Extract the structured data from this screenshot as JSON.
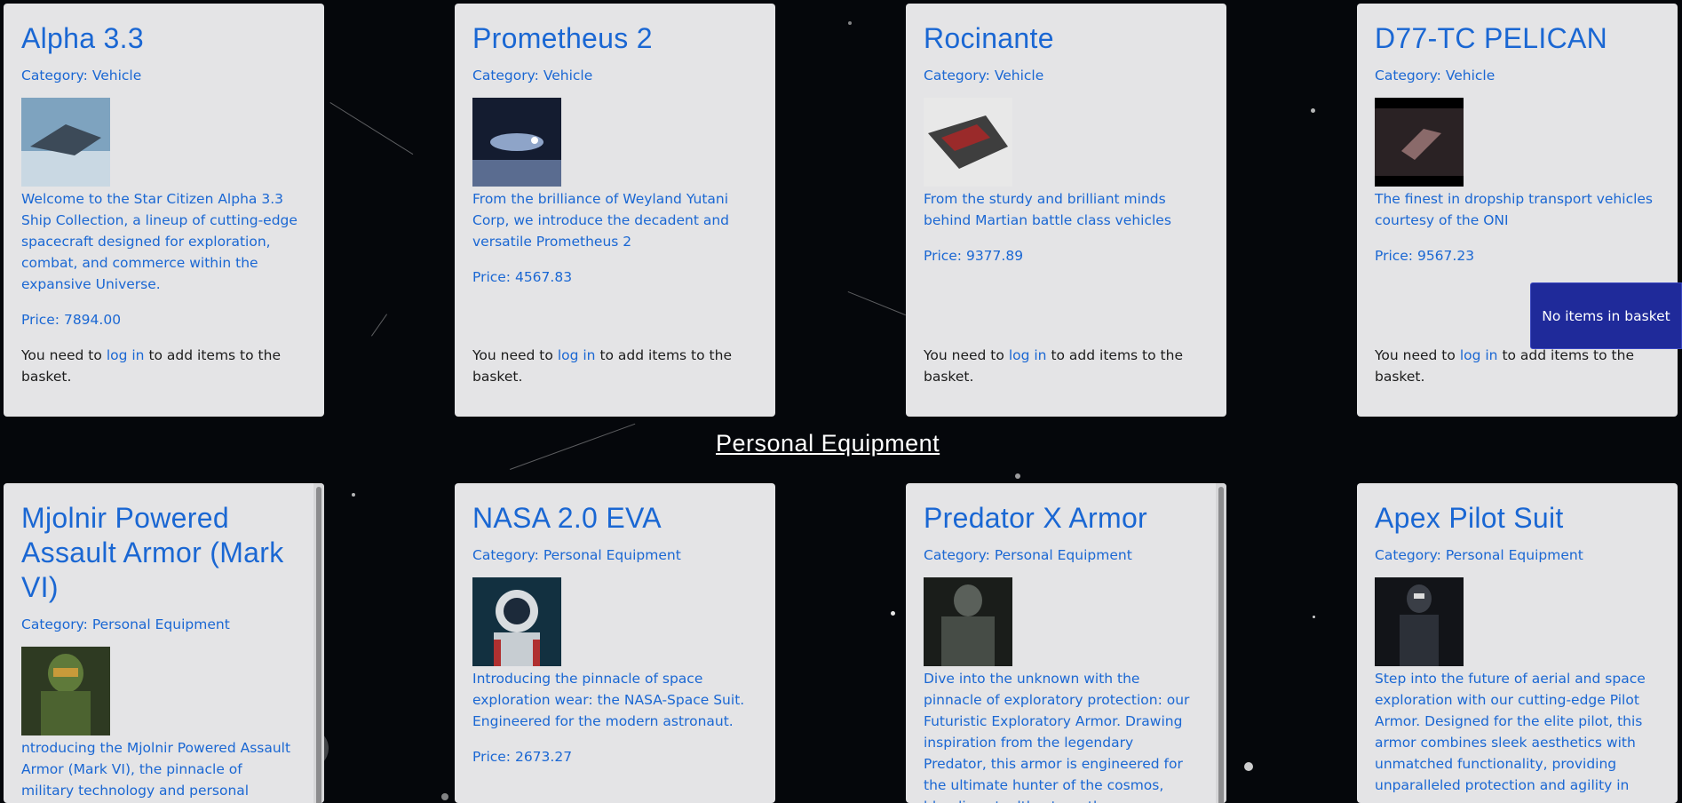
{
  "section": {
    "title": "Personal Equipment"
  },
  "login_prefix": "You need to",
  "login_link": "log in",
  "login_suffix": "to add items to the basket.",
  "basket": {
    "label": "No items in basket"
  },
  "products_row1": [
    {
      "title": "Alpha 3.3",
      "category": "Category: Vehicle",
      "description": "Welcome to the Star Citizen Alpha 3.3 Ship Collection, a lineup of cutting-edge spacecraft designed for exploration, combat, and commerce within the expansive Universe.",
      "price": "Price: 7894.00",
      "image": "spaceship-image"
    },
    {
      "title": "Prometheus 2",
      "category": "Category: Vehicle",
      "description": "From the brilliance of Weyland Yutani Corp, we introduce the decadent and versatile Prometheus 2",
      "price": "Price: 4567.83",
      "image": "spaceship-image"
    },
    {
      "title": "Rocinante",
      "category": "Category: Vehicle",
      "description": "From the sturdy and brilliant minds behind Martian battle class vehicles",
      "price": "Price: 9377.89",
      "image": "spaceship-image"
    },
    {
      "title": "D77-TC PELICAN",
      "category": "Category: Vehicle",
      "description": "The finest in dropship transport vehicles courtesy of the ONI",
      "price": "Price: 9567.23",
      "image": "dropship-image"
    }
  ],
  "products_row2": [
    {
      "title": "Mjolnir Powered Assault Armor (Mark VI)",
      "category": "Category: Personal Equipment",
      "description": "ntroducing the Mjolnir Powered Assault Armor (Mark VI), the pinnacle of military technology and personal protection in",
      "image": "armor-image"
    },
    {
      "title": "NASA 2.0 EVA",
      "category": "Category: Personal Equipment",
      "description": "Introducing the pinnacle of space exploration wear: the NASA-Space Suit. Engineered for the modern astronaut.",
      "price": "Price: 2673.27",
      "image": "astronaut-image"
    },
    {
      "title": "Predator X Armor",
      "category": "Category: Personal Equipment",
      "description": "Dive into the unknown with the pinnacle of exploratory protection: our Futuristic Exploratory Armor. Drawing inspiration from the legendary Predator, this armor is engineered for the ultimate hunter of the cosmos, blending stealth, strength,",
      "image": "armor-image"
    },
    {
      "title": "Apex Pilot Suit",
      "category": "Category: Personal Equipment",
      "description": "Step into the future of aerial and space exploration with our cutting-edge Pilot Armor. Designed for the elite pilot, this armor combines sleek aesthetics with unmatched functionality, providing unparalleled protection and agility in",
      "image": "pilot-suit-image"
    }
  ]
}
